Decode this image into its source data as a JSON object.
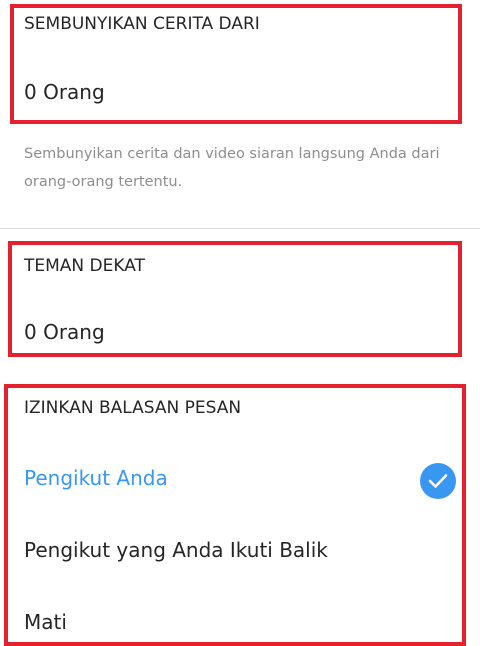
{
  "hide_story": {
    "header": "SEMBUNYIKAN CERITA DARI",
    "value": "0 Orang",
    "description": "Sembunyikan cerita dan video siaran langsung Anda dari orang-orang tertentu."
  },
  "close_friends": {
    "header": "TEMAN DEKAT",
    "value": "0 Orang"
  },
  "message_replies": {
    "header": "IZINKAN BALASAN PESAN",
    "options": [
      {
        "label": "Pengikut Anda",
        "selected": true
      },
      {
        "label": "Pengikut yang Anda Ikuti Balik",
        "selected": false
      },
      {
        "label": "Mati",
        "selected": false
      }
    ]
  },
  "colors": {
    "accent": "#3897f0",
    "highlight_border": "#e3212f",
    "text": "#262626",
    "muted": "#8e8e8e"
  },
  "icons": {
    "selected_check": "checkmark-circle-icon"
  }
}
